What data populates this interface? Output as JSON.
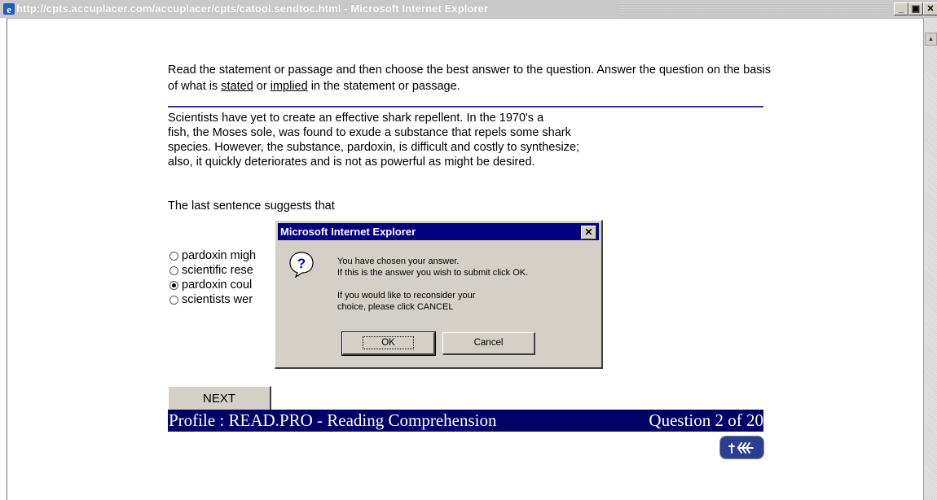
{
  "window": {
    "title": "http://cpts.accuplacer.com/accuplacer/cpts/catool.sendtoc.html - Microsoft Internet Explorer",
    "min_label": "_",
    "max_label": "▣",
    "close_label": "✕",
    "icon": "ie-icon"
  },
  "content": {
    "instr_part1": "Read the statement or passage and then choose the best answer to the question.  Answer the question on the basis of what is ",
    "instr_stated": "stated",
    "instr_or": " or ",
    "instr_implied": "implied",
    "instr_end": " in the statement or passage.",
    "passage_lines": [
      "Scientists have yet to create an effective shark repellent.  In the 1970's a",
      "fish, the Moses sole, was found to exude a substance that repels some shark",
      "species.  However, the substance, pardoxin, is difficult and costly to synthesize;",
      "also, it quickly deteriorates and is not as powerful as might be desired."
    ],
    "question": "The last sentence suggests that",
    "options": [
      {
        "label": "pardoxin migh",
        "checked": false
      },
      {
        "label": "scientific rese",
        "checked": false
      },
      {
        "label": "pardoxin coul",
        "checked": true
      },
      {
        "label": "scientists wer",
        "checked": false
      }
    ],
    "next_label": "NEXT"
  },
  "footer": {
    "profile": "Profile : READ.PRO - Reading Comprehension",
    "question_count": "Question 2 of 20"
  },
  "dialog": {
    "title": "Microsoft Internet Explorer",
    "close_label": "✕",
    "icon": "question-icon",
    "line1": "You have chosen your answer.",
    "line2": "If this is the answer you wish to submit click OK.",
    "line3": "If you would like to reconsider your",
    "line4": "choice, please click CANCEL",
    "ok_label": "OK",
    "cancel_label": "Cancel"
  },
  "colors": {
    "title_blue": "#000080",
    "footer_bar": "#000066",
    "divider": "#333399"
  }
}
